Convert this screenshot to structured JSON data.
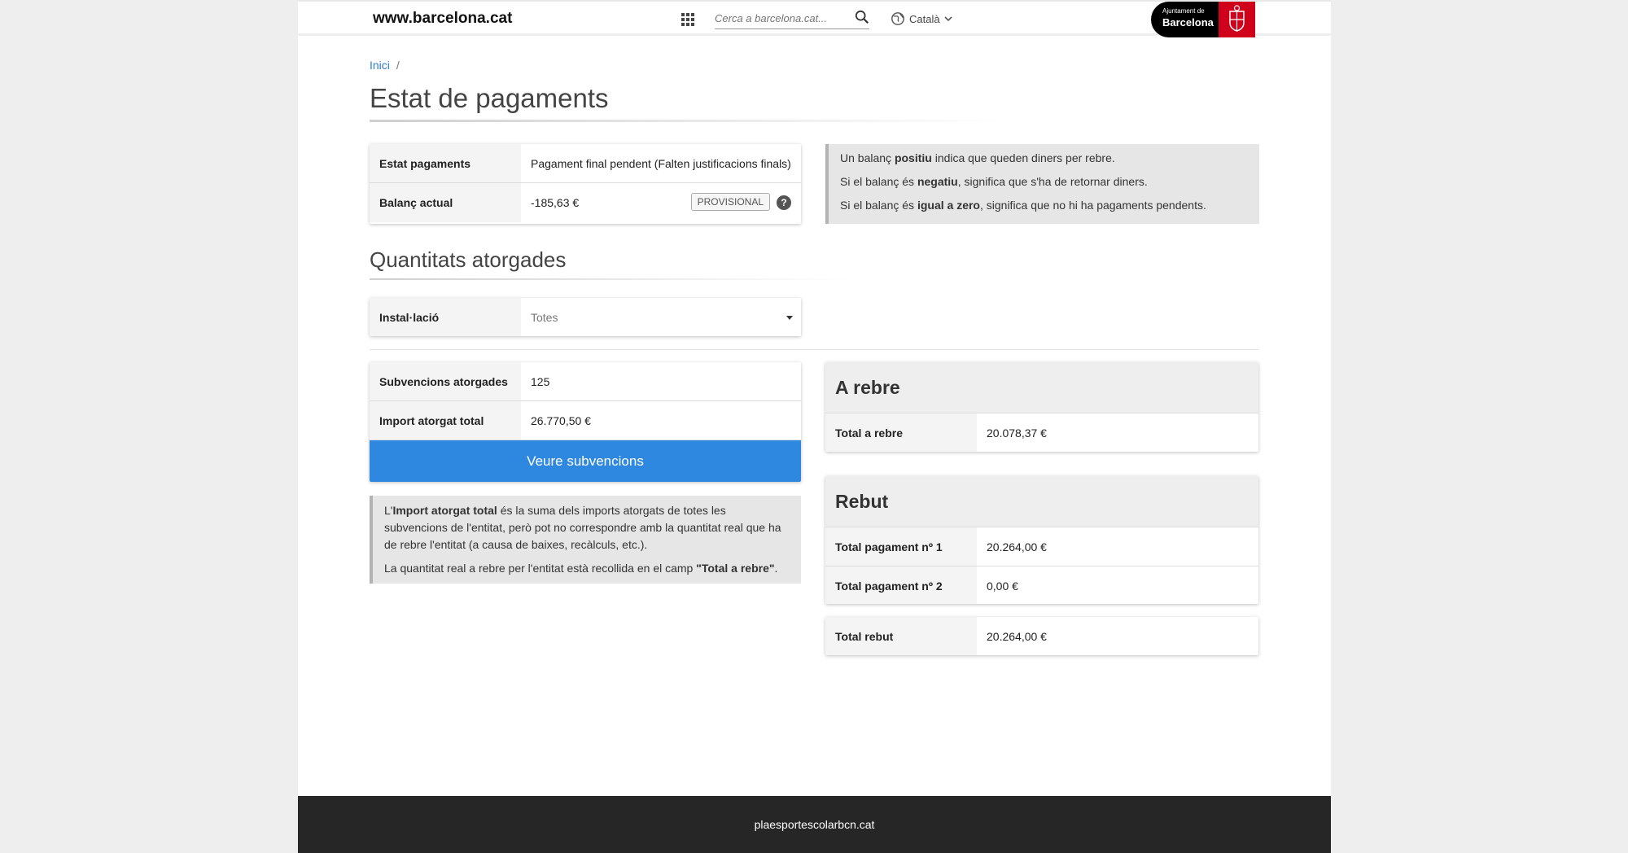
{
  "header": {
    "site_url": "www.barcelona.cat",
    "search_placeholder": "Cerca a barcelona.cat...",
    "language": "Català",
    "logo_small": "Ajuntament de",
    "logo_big": "Barcelona"
  },
  "breadcrumb": {
    "home": "Inici",
    "separator": "/"
  },
  "page_title": "Estat de pagaments",
  "status_card": {
    "rows": [
      {
        "label": "Estat pagaments",
        "value": "Pagament final pendent (Falten justificacions finals)"
      },
      {
        "label": "Balanç actual",
        "value": "-185,63 €",
        "badge": "PROVISIONAL"
      }
    ]
  },
  "balance_note": {
    "line1_pre": "Un balanç ",
    "line1_bold": "positiu",
    "line1_post": " indica que queden diners per rebre.",
    "line2_pre": "Si el balanç és ",
    "line2_bold": "negatiu",
    "line2_post": ", significa que s'ha de retornar diners.",
    "line3_pre": "Si el balanç és ",
    "line3_bold": "igual a zero",
    "line3_post": ", significa que no hi ha pagaments pendents."
  },
  "section_title": "Quantitats atorgades",
  "installation_filter": {
    "label": "Instal·lació",
    "value": "Totes"
  },
  "grants_card": {
    "rows": [
      {
        "label": "Subvencions atorgades",
        "value": "125"
      },
      {
        "label": "Import atorgat total",
        "value": "26.770,50 €"
      }
    ],
    "button": "Veure subvencions"
  },
  "grants_note": {
    "p1_pre": "L'",
    "p1_bold": "Import atorgat total",
    "p1_post": " és la suma dels imports atorgats de totes les subvencions de l'entitat, però pot no correspondre amb la quantitat real que ha de rebre l'entitat (a causa de baixes, recàlculs, etc.).",
    "p2_pre": "La quantitat real a rebre per l'entitat està recollida en el camp ",
    "p2_bold": "\"Total a rebre\"",
    "p2_post": "."
  },
  "to_receive": {
    "title": "A rebre",
    "rows": [
      {
        "label": "Total a rebre",
        "value": "20.078,37 €"
      }
    ]
  },
  "received": {
    "title": "Rebut",
    "rows": [
      {
        "label": "Total pagament nº 1",
        "value": "20.264,00 €"
      },
      {
        "label": "Total pagament nº 2",
        "value": "0,00 €"
      }
    ]
  },
  "total_received": {
    "label": "Total rebut",
    "value": "20.264,00 €"
  },
  "footer": {
    "text": "plaesportescolarbcn.cat"
  }
}
